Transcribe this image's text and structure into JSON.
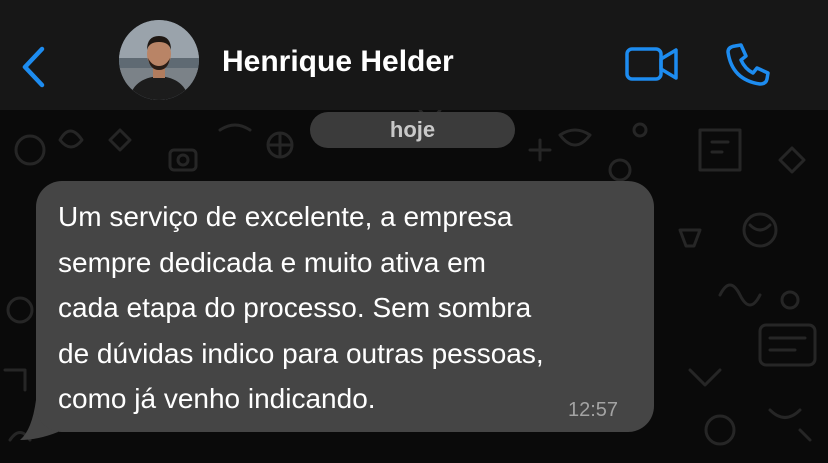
{
  "header": {
    "contact_name": "Henrique Helder",
    "back_icon": "chevron-left-icon",
    "video_icon": "video-camera-icon",
    "call_icon": "phone-icon",
    "accent_color": "#1d8cf0",
    "background_color": "#171717"
  },
  "chat": {
    "date_label": "hoje",
    "background_color": "#0a0a0a",
    "messages": [
      {
        "lines": [
          "Um serviço de excelente, a empresa",
          "sempre dedicada e muito ativa em",
          "cada etapa do processo. Sem sombra",
          "de dúvidas indico para outras pessoas,",
          "como já venho indicando."
        ],
        "time": "12:57",
        "bubble_color": "#454545"
      }
    ]
  }
}
